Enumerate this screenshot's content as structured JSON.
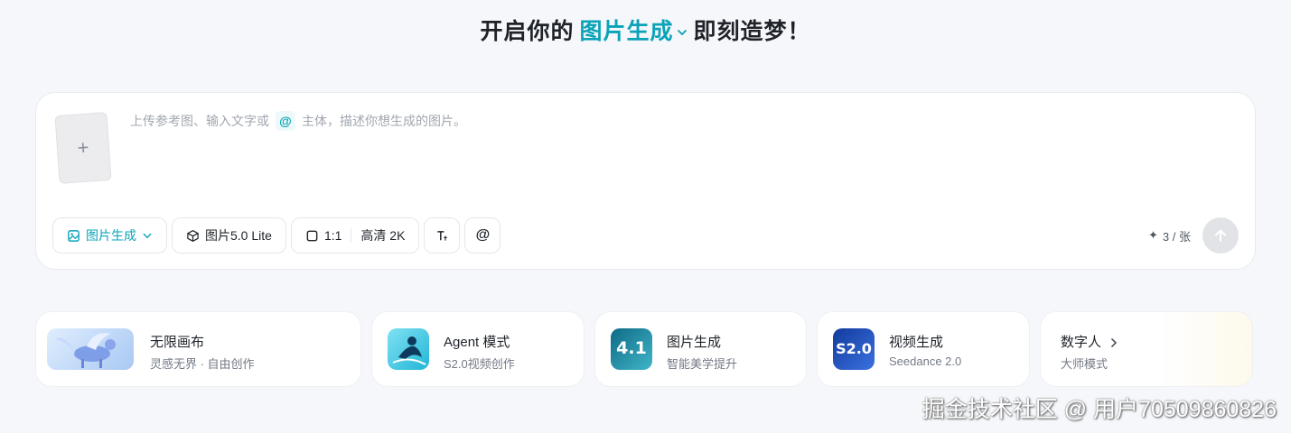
{
  "headline": {
    "before": "开启你的",
    "mode": "图片生成",
    "after": "即刻造梦！"
  },
  "composer": {
    "upload_symbol": "+",
    "prompt_before": "上传参考图、输入文字或",
    "prompt_mention": "@",
    "prompt_after": "主体，描述你想生成的图片。"
  },
  "toolbar": {
    "mode_label": "图片生成",
    "model_label": "图片5.0 Lite",
    "ratio_label": "1:1",
    "quality_label": "高清 2K",
    "mention_label": "@"
  },
  "credits": {
    "symbol": "✦",
    "text": "3 / 张"
  },
  "cards": [
    {
      "title": "无限画布",
      "subtitle": "灵感无界 · 自由创作",
      "icon": "pegasus-icon"
    },
    {
      "title": "Agent 模式",
      "subtitle": "S2.0视频创作",
      "icon": "agent-icon"
    },
    {
      "title": "图片生成",
      "subtitle": "智能美学提升",
      "icon": "image-4-1-icon",
      "thumb_text": "4.1"
    },
    {
      "title": "视频生成",
      "subtitle": "Seedance 2.0",
      "icon": "video-s2-icon",
      "thumb_text": "S2.0"
    },
    {
      "title": "数字人",
      "subtitle": "大师模式",
      "icon": "chevron-right-icon"
    }
  ],
  "colors": {
    "accent": "#0aa3b8",
    "background": "#f5f7fa"
  },
  "watermark": "掘金技术社区 @ 用户70509860826"
}
